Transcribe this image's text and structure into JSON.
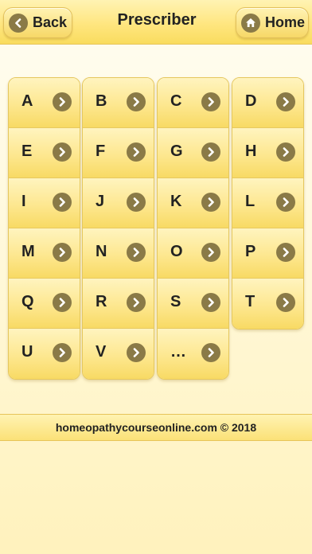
{
  "header": {
    "title": "Prescriber",
    "back_label": "Back",
    "home_label": "Home"
  },
  "letters": {
    "col1": [
      "A",
      "E",
      "I",
      "M",
      "Q",
      "U"
    ],
    "col2": [
      "B",
      "F",
      "J",
      "N",
      "R",
      "V"
    ],
    "col3": [
      "C",
      "G",
      "K",
      "O",
      "S",
      "…"
    ],
    "col4": [
      "D",
      "H",
      "L",
      "P",
      "T"
    ]
  },
  "footer": {
    "text": "homeopathycourseonline.com © 2018"
  },
  "icons": {
    "back": "chevron-left-icon",
    "home": "house-icon",
    "row": "chevron-right-icon"
  },
  "colors": {
    "accent": "#f8da64",
    "icon": "#8a7a47"
  }
}
